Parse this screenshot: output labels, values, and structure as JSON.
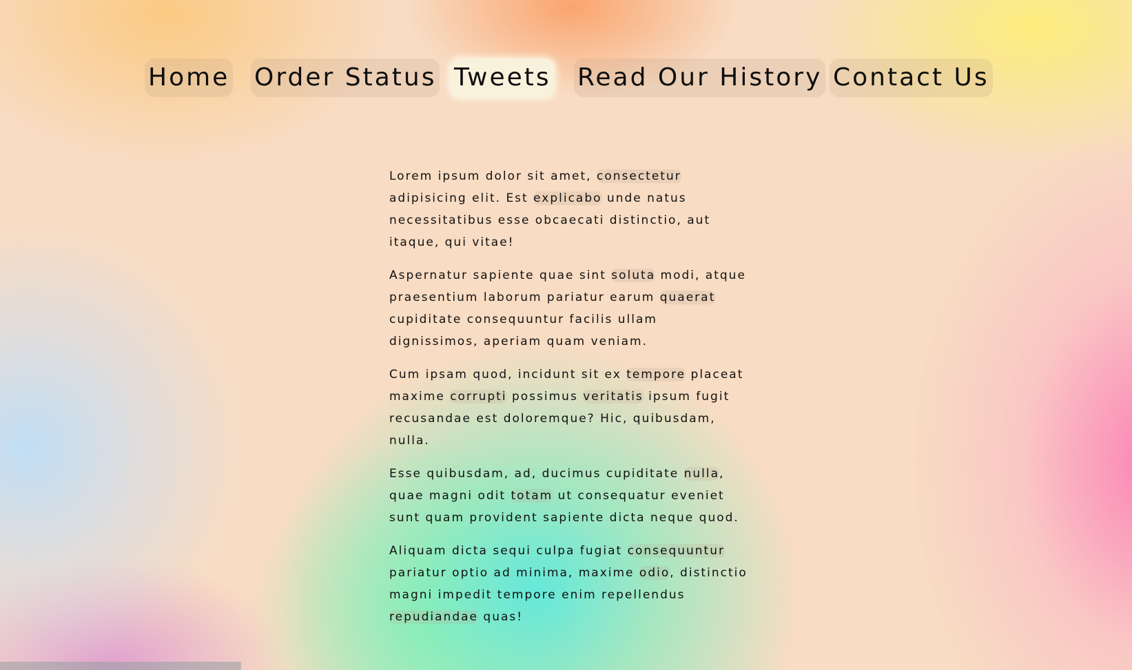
{
  "nav": {
    "items": [
      {
        "label": "Home",
        "active": false
      },
      {
        "label": "Order Status",
        "active": false
      },
      {
        "label": "Tweets",
        "active": true
      },
      {
        "label": "Read Our History",
        "active": false
      },
      {
        "label": "Contact Us",
        "active": false
      }
    ]
  },
  "content": {
    "paragraphs": [
      [
        {
          "t": "Lorem ipsum dolor sit amet, "
        },
        {
          "t": "consectetur",
          "hl": true
        },
        {
          "t": " adipisicing elit. Est "
        },
        {
          "t": "explicabo",
          "hl": true
        },
        {
          "t": " unde natus necessitatibus esse obcaecati distinctio, aut itaque, qui vitae!"
        }
      ],
      [
        {
          "t": "Aspernatur sapiente quae sint "
        },
        {
          "t": "soluta",
          "hl": true
        },
        {
          "t": " modi, atque praesentium laborum pariatur earum "
        },
        {
          "t": "quaerat",
          "hl": true
        },
        {
          "t": " cupiditate consequuntur facilis ullam dignissimos, aperiam quam veniam."
        }
      ],
      [
        {
          "t": "Cum ipsam quod, incidunt sit ex "
        },
        {
          "t": "tempore",
          "hl": true
        },
        {
          "t": " placeat maxime "
        },
        {
          "t": "corrupti",
          "hl": true
        },
        {
          "t": " possimus "
        },
        {
          "t": "veritatis",
          "hl": true
        },
        {
          "t": " ipsum fugit recusandae est doloremque? Hic, quibusdam, nulla."
        }
      ],
      [
        {
          "t": "Esse quibusdam, ad, ducimus cupiditate "
        },
        {
          "t": "nulla",
          "hl": true
        },
        {
          "t": ", quae magni odit "
        },
        {
          "t": "totam",
          "hl": true
        },
        {
          "t": " ut consequatur eveniet sunt quam provident sapiente dicta neque quod."
        }
      ],
      [
        {
          "t": "Aliquam dicta sequi culpa fugiat "
        },
        {
          "t": "consequuntur",
          "hl": true
        },
        {
          "t": " pariatur optio ad minima, maxime "
        },
        {
          "t": "odio",
          "hl": true
        },
        {
          "t": ", distinctio magni impedit tempore enim repellendus "
        },
        {
          "t": "repudiandae",
          "hl": true
        },
        {
          "t": " quas!"
        }
      ]
    ]
  },
  "colors": {
    "background": "#f8dcc3",
    "active_tab": "#f8f2dd",
    "text": "#111111"
  }
}
